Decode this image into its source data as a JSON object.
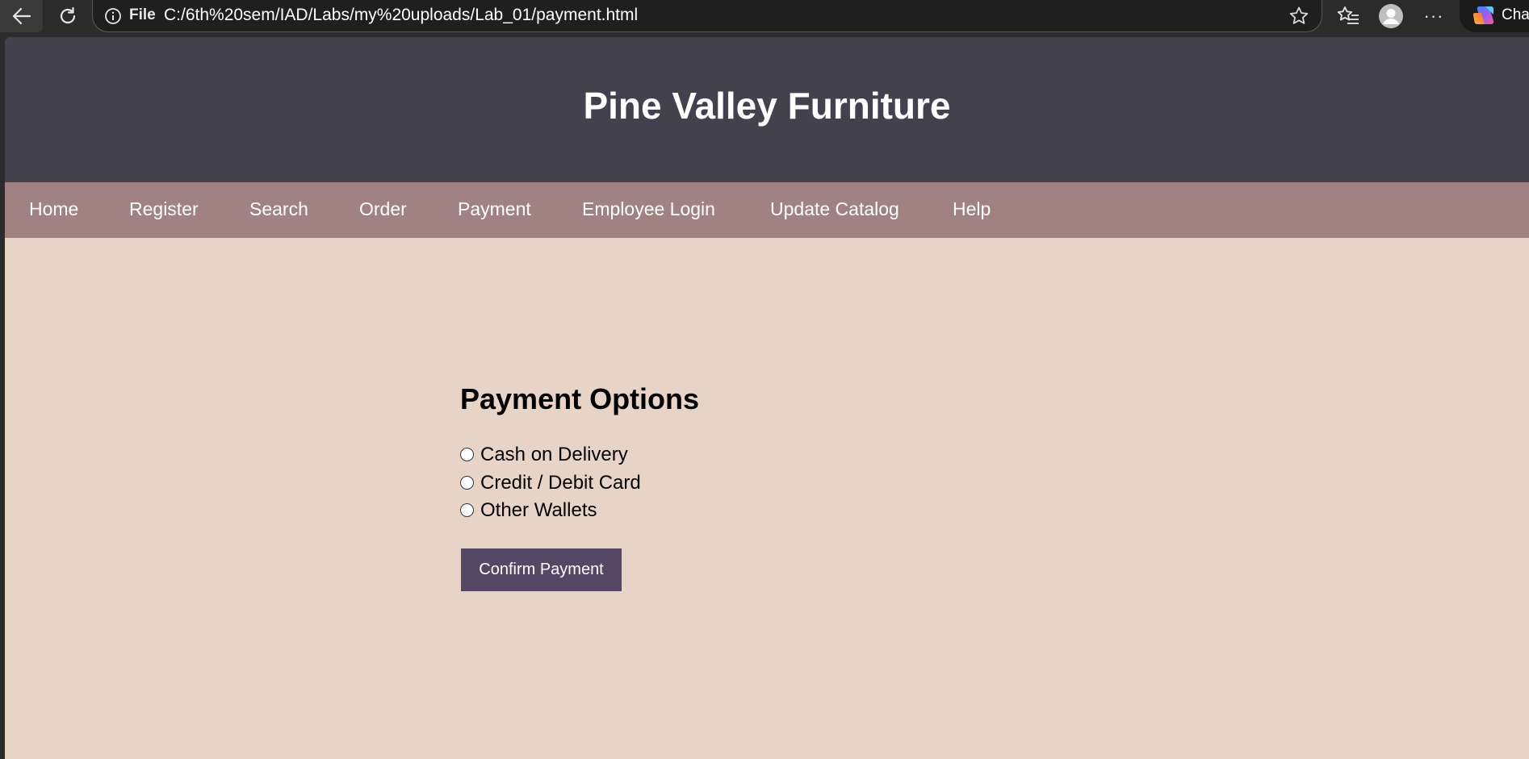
{
  "browser": {
    "address_scheme": "File",
    "url": "C:/6th%20sem/IAD/Labs/my%20uploads/Lab_01/payment.html",
    "copilot_label": "Chat",
    "more_label": "···"
  },
  "site": {
    "title": "Pine Valley Furniture",
    "nav": [
      "Home",
      "Register",
      "Search",
      "Order",
      "Payment",
      "Employee Login",
      "Update Catalog",
      "Help"
    ]
  },
  "payment": {
    "heading": "Payment Options",
    "options": [
      "Cash on Delivery",
      "Credit / Debit Card",
      "Other Wallets"
    ],
    "confirm_label": "Confirm Payment"
  },
  "colors": {
    "header_bg": "#43414d",
    "nav_bg": "#a08283",
    "page_bg": "#e8d3c7",
    "button_bg": "#554766"
  }
}
